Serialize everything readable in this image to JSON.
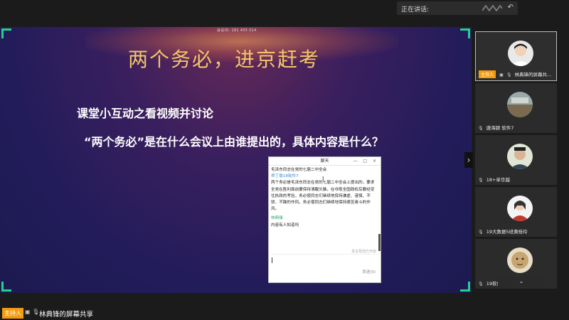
{
  "topbar": {
    "speaking_label": "正在讲话:",
    "back_icon": "undo-icon"
  },
  "screen": {
    "uid_text": "会议ID: 181 455 014",
    "title": "两个务必，进京赶考",
    "subtitle": "课堂小互动之看视频并讨论",
    "question": "“两个务必”是在什么会议上由谁提出的，具体内容是什么？",
    "accent_color": "#23d38a"
  },
  "chat": {
    "title": "聊天",
    "controls": "— □ ×",
    "messages": [
      {
        "line": "毛泽东同志在党的七届二中全会"
      },
      {
        "sender": "郑丁豪18软件7"
      },
      {
        "line": "两个务必是毛泽东同志在党的七届二中全会上提出的，要求全党在胜利面前要保持清醒头脑，在夺取全国政权后要经受住执政的考验，务必使同志们继续地保持谦虚、谨慎、不骄、不躁的作风，务必使同志们继续地保持艰苦奋斗的作风。"
      },
      {
        "sender": "林典锋"
      },
      {
        "line": "内容有人知道吗"
      }
    ],
    "hint": "发言规范已开启",
    "send_label": "发送(S)"
  },
  "participants": [
    {
      "name": "林典锋的屏幕共...",
      "host": true,
      "host_label": "主持人"
    },
    {
      "name": "唐海颖 软件7"
    },
    {
      "name": "18+单华越"
    },
    {
      "name": "19大数据5班黄桂玲"
    },
    {
      "name": "19软件7 吴可欣"
    }
  ],
  "panel_footer": "⌄",
  "bottom": {
    "host_label": "主持人",
    "share_name": "林典锋的屏幕共享"
  }
}
